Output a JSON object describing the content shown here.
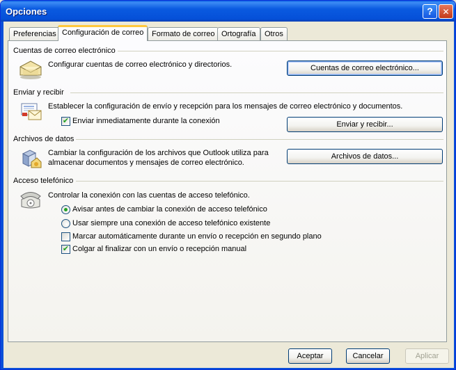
{
  "window": {
    "title": "Opciones",
    "help_glyph": "?",
    "close_glyph": "✕"
  },
  "tabs": [
    {
      "label": "Preferencias"
    },
    {
      "label": "Configuración de correo"
    },
    {
      "label": "Formato de correo"
    },
    {
      "label": "Ortografía"
    },
    {
      "label": "Otros"
    }
  ],
  "active_tab": "Configuración de correo",
  "sections": {
    "accounts": {
      "title": "Cuentas de correo electrónico",
      "description": "Configurar cuentas de correo electrónico y directorios.",
      "button": "Cuentas de correo electrónico...",
      "icon": "mail-accounts-icon"
    },
    "send_receive": {
      "title": "Enviar y recibir",
      "description": "Establecer la configuración de envío y recepción para los mensajes de correo electrónico y documentos.",
      "checkbox_label": "Enviar inmediatamente durante la conexión",
      "checkbox_checked": true,
      "button": "Enviar y recibir...",
      "icon": "send-receive-icon"
    },
    "data_files": {
      "title": "Archivos de datos",
      "description_line1": "Cambiar la configuración de los archivos que Outlook utiliza para",
      "description_line2": "almacenar documentos y mensajes de correo electrónico.",
      "button": "Archivos de datos...",
      "icon": "data-files-icon"
    },
    "dialup": {
      "title": "Acceso telefónico",
      "description": "Controlar la conexión con las cuentas de acceso telefónico.",
      "icon": "telephone-icon",
      "radio1": "Avisar antes de cambiar la conexión de acceso telefónico",
      "radio1_selected": true,
      "radio2": "Usar siempre una conexión de acceso telefónico existente",
      "radio2_selected": false,
      "check1": "Marcar automáticamente durante un envío o recepción en segundo plano",
      "check1_checked": false,
      "check2": "Colgar al finalizar con un envío o recepción manual",
      "check2_checked": true
    }
  },
  "footer": {
    "accept": "Aceptar",
    "cancel": "Cancelar",
    "apply": "Aplicar"
  },
  "check_glyph": "✔",
  "colors": {
    "titlebar": "#0a5ae0",
    "active_tab_accent": "#ffc83c",
    "check_green": "#21a121",
    "dialog_bg": "#ece9d8"
  }
}
